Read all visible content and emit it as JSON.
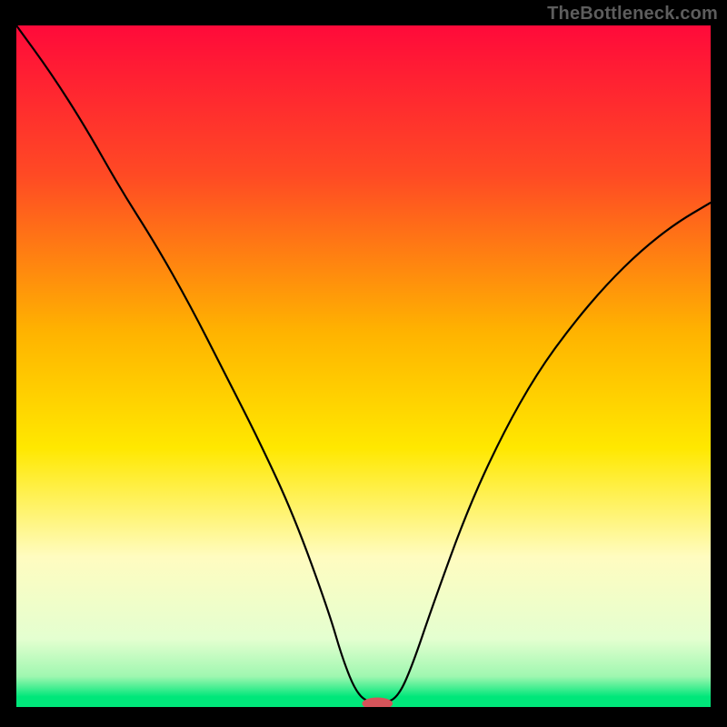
{
  "watermark": "TheBottleneck.com",
  "chart_data": {
    "type": "line",
    "title": "",
    "xlabel": "",
    "ylabel": "",
    "xlim": [
      0,
      100
    ],
    "ylim": [
      0,
      100
    ],
    "grid": false,
    "legend": false,
    "background_gradient_stops": [
      {
        "offset": 0.0,
        "color": "#ff0a3a"
      },
      {
        "offset": 0.22,
        "color": "#ff4a24"
      },
      {
        "offset": 0.45,
        "color": "#ffb300"
      },
      {
        "offset": 0.62,
        "color": "#ffe800"
      },
      {
        "offset": 0.78,
        "color": "#fffcc0"
      },
      {
        "offset": 0.9,
        "color": "#e4ffd0"
      },
      {
        "offset": 0.955,
        "color": "#9ff7b0"
      },
      {
        "offset": 0.985,
        "color": "#00e77a"
      },
      {
        "offset": 1.0,
        "color": "#00e77a"
      }
    ],
    "series": [
      {
        "name": "bottleneck-curve",
        "stroke": "#000000",
        "stroke_width": 2.2,
        "x": [
          0,
          5,
          10,
          15,
          20,
          25,
          30,
          35,
          40,
          45,
          47,
          49,
          51,
          53,
          55,
          57,
          60,
          65,
          70,
          75,
          80,
          85,
          90,
          95,
          100
        ],
        "values": [
          100,
          93,
          85,
          76,
          68,
          59,
          49,
          39,
          28,
          14,
          7,
          2,
          0.5,
          0.5,
          1.5,
          6,
          15,
          29,
          40,
          49,
          56,
          62,
          67,
          71,
          74
        ]
      }
    ],
    "marker": {
      "name": "optimal-marker",
      "cx": 52,
      "cy": 0.5,
      "rx": 2.2,
      "ry": 0.9,
      "fill": "#d5545a"
    }
  }
}
